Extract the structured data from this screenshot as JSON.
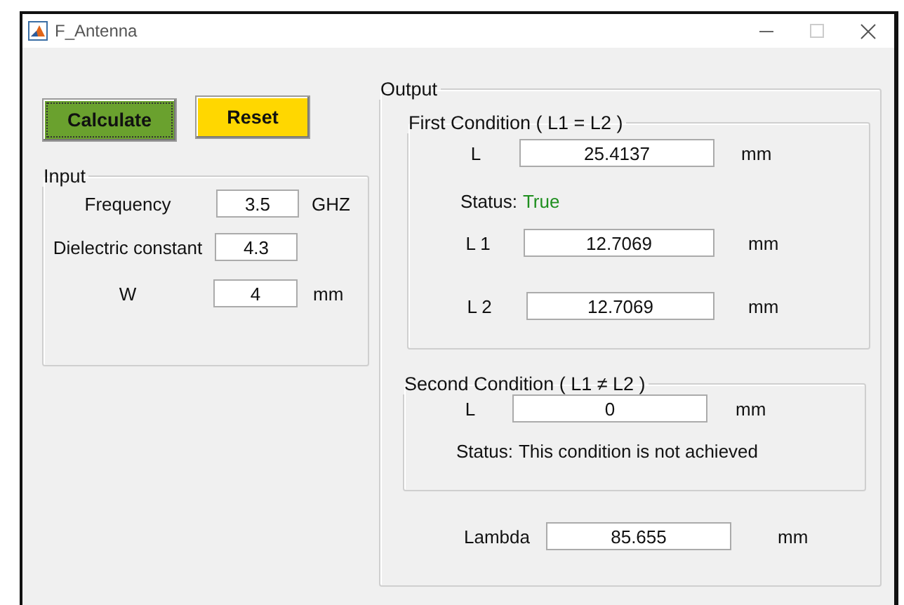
{
  "window": {
    "title": "F_Antenna"
  },
  "buttons": [
    {
      "label": "Calculate",
      "color": "#6aa12e",
      "focused": true
    },
    {
      "label": "Reset",
      "color": "#ffd700",
      "focused": false
    }
  ],
  "input_panel": {
    "title": "Input",
    "fields": [
      {
        "label": "Frequency",
        "value": "3.5",
        "unit": "GHZ"
      },
      {
        "label": "Dielectric constant",
        "value": "4.3"
      },
      {
        "label": "W",
        "value": "4",
        "unit": "mm"
      }
    ]
  },
  "output_panel": {
    "title": "Output",
    "first_condition": {
      "title": "First Condition ( L1 = L2 )",
      "rows": [
        {
          "kind": "field",
          "label": "L",
          "value": "25.4137",
          "unit": "mm"
        },
        {
          "kind": "status",
          "label": "Status:",
          "value": "True",
          "ok": true
        },
        {
          "kind": "field",
          "label": "L 1",
          "value": "12.7069",
          "unit": "mm"
        },
        {
          "kind": "field",
          "label": "L 2",
          "value": "12.7069",
          "unit": "mm"
        }
      ]
    },
    "second_condition": {
      "title": "Second Condition ( L1 ≠ L2  )",
      "rows": [
        {
          "kind": "field",
          "label": "L",
          "value": "0",
          "unit": "mm"
        },
        {
          "kind": "status",
          "label": "Status:",
          "value": "This condition is not achieved",
          "ok": false
        }
      ]
    },
    "lambda": {
      "label": "Lambda",
      "value": "85.655",
      "unit": "mm"
    }
  }
}
